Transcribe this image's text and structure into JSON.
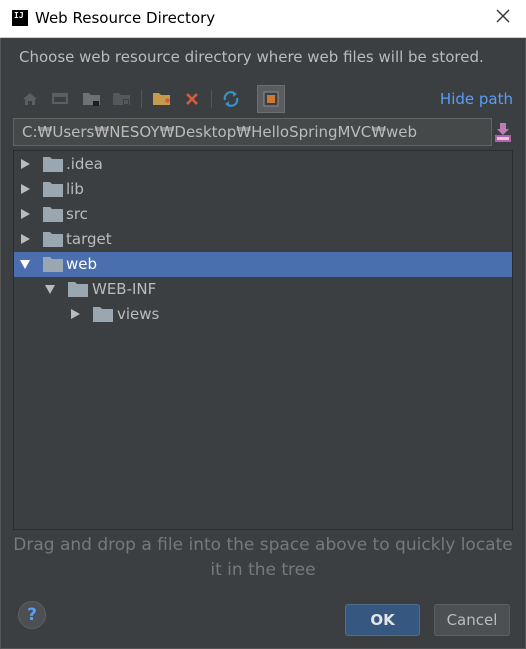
{
  "window": {
    "app_icon_text": "IJ",
    "title": "Web Resource Directory"
  },
  "description": "Choose web resource directory where web files will be stored.",
  "toolbar": {
    "icons": [
      "home-icon",
      "desktop-icon",
      "project-icon",
      "module-icon",
      "new-folder-icon",
      "delete-icon",
      "refresh-icon",
      "show-hidden-icon"
    ],
    "hide_path_label": "Hide path"
  },
  "path": {
    "value": "C:₩Users₩NESOY₩Desktop₩HelloSpringMVC₩web"
  },
  "tree": {
    "items": [
      {
        "label": ".idea",
        "expanded": false
      },
      {
        "label": "lib",
        "expanded": false
      },
      {
        "label": "src",
        "expanded": false
      },
      {
        "label": "target",
        "expanded": false
      },
      {
        "label": "web",
        "expanded": true,
        "selected": true
      },
      {
        "label": "WEB-INF",
        "expanded": true
      },
      {
        "label": "views",
        "expanded": false
      }
    ]
  },
  "hint": {
    "line1": "Drag and drop a file into the space above to quickly locate",
    "line2": "it in the tree"
  },
  "buttons": {
    "help": "?",
    "ok": "OK",
    "cancel": "Cancel"
  },
  "colors": {
    "background": "#3c3f41",
    "selection": "#4b6eaf",
    "link": "#589df6",
    "folder": "#9aa7b0"
  }
}
